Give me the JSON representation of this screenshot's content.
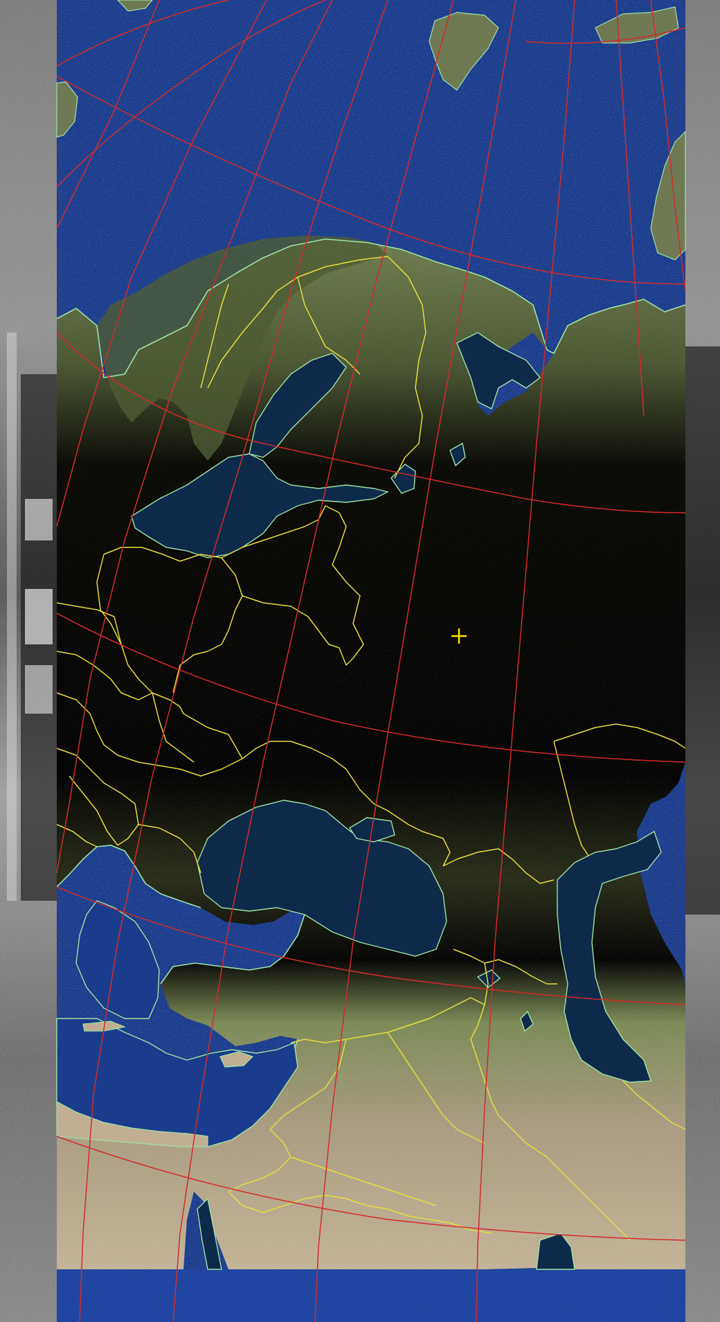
{
  "image": {
    "kind": "satellite-weather-image-with-map-overlay",
    "overlay_colors": {
      "graticule": "#d42a2a",
      "borders": "#e6dc3c",
      "coastline": "#9fe3a6",
      "marker": "#ffe400"
    },
    "surface_colors": {
      "ocean": "#1a3c8c",
      "land_dark": "#050505",
      "land_vegetation": "#7c8a58",
      "land_arid": "#bfae92",
      "inland_water": "#0e2a4a",
      "noise_strip": "#7a7a7a"
    },
    "marker": {
      "icon": "crosshair-icon"
    }
  }
}
